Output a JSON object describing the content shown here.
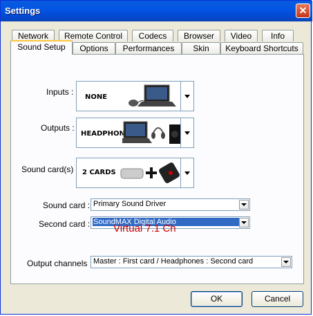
{
  "window": {
    "title": "Settings"
  },
  "tabs_row1": [
    "Network",
    "Remote Control",
    "Codecs",
    "Browser",
    "Video",
    "Info"
  ],
  "tabs_row2": [
    "Sound Setup",
    "Options",
    "Performances",
    "Skin",
    "Keyboard Shortcuts"
  ],
  "active_tab": "Sound Setup",
  "fields": {
    "inputs": {
      "label": "Inputs :",
      "value": "NONE"
    },
    "outputs": {
      "label": "Outputs :",
      "value": "HEADPHONES"
    },
    "soundcards": {
      "label": "Sound card(s) :",
      "value": "2 CARDS"
    },
    "sound_card": {
      "label": "Sound card :",
      "value": "Primary Sound Driver"
    },
    "second_card": {
      "label": "Second card :",
      "value": "SoundMAX Digital Audio"
    },
    "output_channels": {
      "label": "Output channels :",
      "value": "Master : First card / Headphones : Second card"
    }
  },
  "overlay_text": "Virtual 7.1 Ch",
  "buttons": {
    "ok": "OK",
    "cancel": "Cancel"
  },
  "colors": {
    "titlebar": "#0356e4",
    "selection": "#316ac5",
    "overlay": "#cc0000"
  }
}
